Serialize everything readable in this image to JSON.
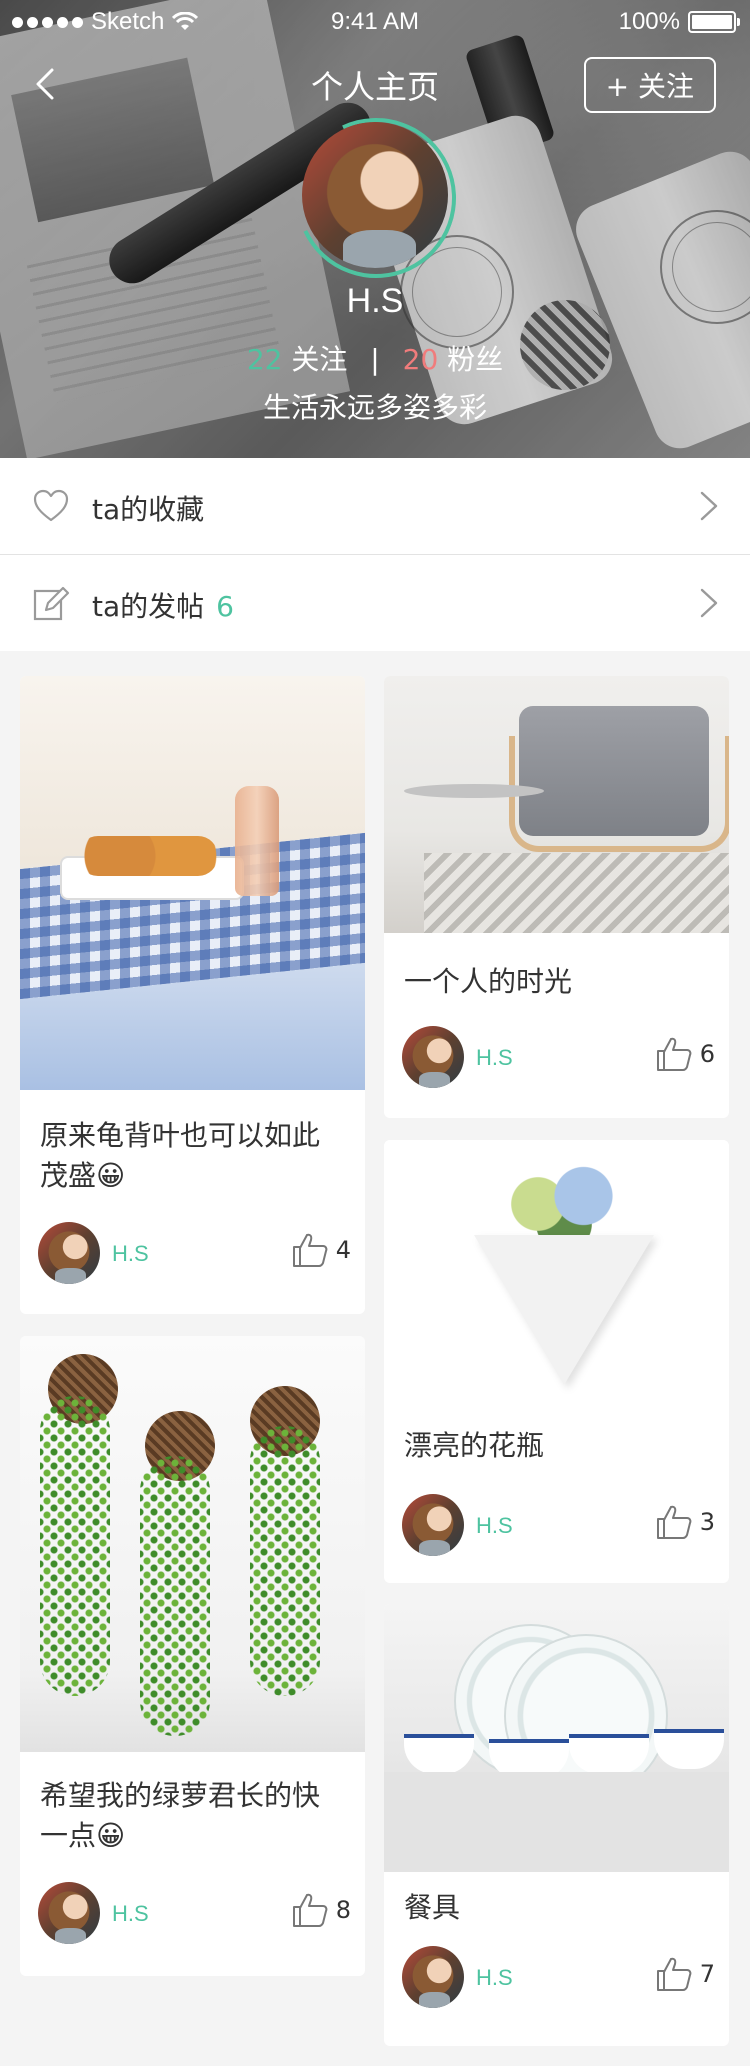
{
  "status_bar": {
    "carrier": "Sketch",
    "time": "9:41 AM",
    "battery": "100%"
  },
  "nav": {
    "title": "个人主页",
    "follow_label": "+ 关注"
  },
  "profile": {
    "name": "H.S",
    "following_count": "22",
    "following_label": "关注",
    "followers_count": "20",
    "followers_label": "粉丝",
    "separator": "|",
    "bio": "生活永远多姿多彩"
  },
  "menu": {
    "favorites_label": "ta的收藏",
    "posts_label": "ta的发帖",
    "posts_count": "6"
  },
  "posts": [
    {
      "title": "原来龟背叶也可以如此茂盛😀",
      "author": "H.S",
      "likes": "4"
    },
    {
      "title": "一个人的时光",
      "author": "H.S",
      "likes": "6"
    },
    {
      "title": "漂亮的花瓶",
      "author": "H.S",
      "likes": "3"
    },
    {
      "title": "希望我的绿萝君长的快一点😀",
      "author": "H.S",
      "likes": "8"
    },
    {
      "title": "餐具",
      "author": "H.S",
      "likes": "7"
    }
  ],
  "colors": {
    "accent_green": "#4ec3a0",
    "accent_red": "#f07c7c",
    "background": "#f4f4f4"
  }
}
